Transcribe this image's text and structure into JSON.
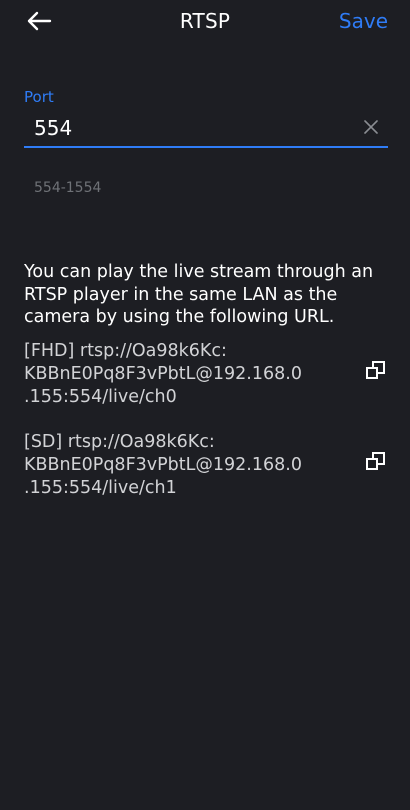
{
  "header": {
    "title": "RTSP",
    "save_label": "Save"
  },
  "port": {
    "label": "Port",
    "value": "554",
    "hint": "554-1554"
  },
  "description": "You can play the live stream through an RTSP player in the same LAN as the camera by using the following URL.",
  "urls": [
    {
      "line1": "[FHD] rtsp://Oa98k6Kc:",
      "line2": "KBBnE0Pq8F3vPbtL@192.168.0",
      "line3": ".155:554/live/ch0"
    },
    {
      "line1": "[SD] rtsp://Oa98k6Kc:",
      "line2": "KBBnE0Pq8F3vPbtL@192.168.0",
      "line3": ".155:554/live/ch1"
    }
  ],
  "icons": {
    "back": "arrow-left-icon",
    "clear": "close-icon",
    "copy": "copy-icon"
  },
  "colors": {
    "background": "#1d1e23",
    "accent": "#2f7cf6",
    "text": "#ffffff",
    "muted": "#6f7277"
  }
}
